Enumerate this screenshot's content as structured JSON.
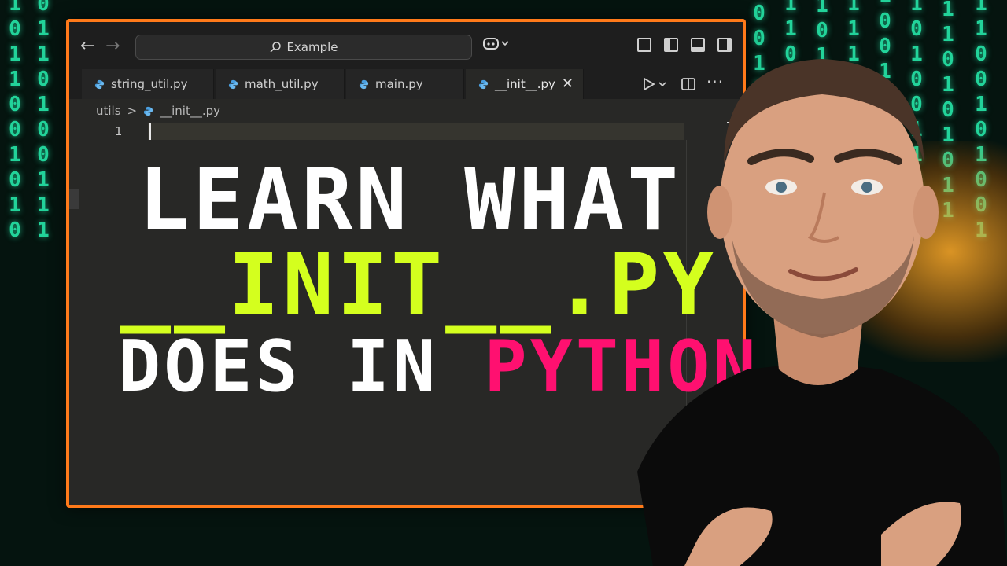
{
  "background": {
    "columns": [
      "1011001010",
      "0110100111",
      "1001011010",
      "1101010011",
      "0101100101",
      "1110010110",
      "1001101010",
      "1010011101",
      "0110101011",
      "1100101001"
    ]
  },
  "window": {
    "nav": {
      "back": "←",
      "forward": "→"
    },
    "search": {
      "label": "Example"
    },
    "tabs": [
      {
        "label": "string_util.py"
      },
      {
        "label": "math_util.py"
      },
      {
        "label": "main.py"
      },
      {
        "label": "__init__.py",
        "active": true
      }
    ],
    "tab_close": "✕",
    "breadcrumb": {
      "folder": "utils",
      "separator": ">",
      "file": "__init__.py"
    },
    "line_number": "1"
  },
  "headline": {
    "line1": "LEARN WHAT",
    "line2": "__INIT__.PY",
    "line3_white": "DOES IN ",
    "line3_pink": "PYTHON"
  },
  "colors": {
    "accent_border": "#ff7a1a",
    "lime": "#d4ff1e",
    "pink": "#ff1070",
    "binary_green": "#22d39a"
  }
}
